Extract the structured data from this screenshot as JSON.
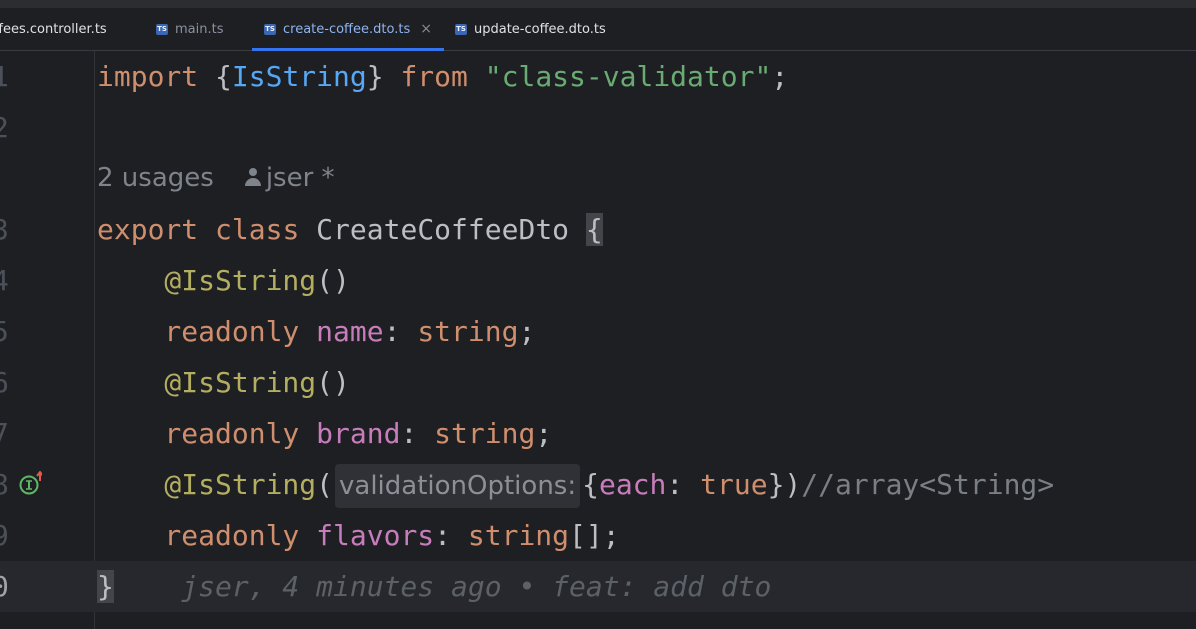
{
  "tabs": [
    {
      "label": "ffees.controller.ts",
      "icon": "ts-file-icon",
      "active": false
    },
    {
      "label": "main.ts",
      "icon": "ts-file-icon",
      "active": false
    },
    {
      "label": "create-coffee.dto.ts",
      "icon": "ts-file-icon",
      "active": true,
      "close": "×"
    },
    {
      "label": "update-coffee.dto.ts",
      "icon": "ts-file-icon",
      "active": false
    }
  ],
  "ts_icon_text": "TS",
  "lines": {
    "l1": {
      "num": "1",
      "import_kw": "import",
      "brace_open": " {",
      "name": "IsString",
      "brace_close": "} ",
      "from_kw": "from",
      "module": " \"class-validator\"",
      "semi": ";"
    },
    "l2": {
      "num": "2"
    },
    "usages": {
      "count": "2 usages",
      "author": "jser *"
    },
    "l3": {
      "num": "3",
      "export_kw": "export",
      "class_kw": " class",
      "class_name": " CreateCoffeeDto ",
      "brace": "{"
    },
    "l4": {
      "num": "4",
      "decorator": "    @IsString",
      "args": "()"
    },
    "l5": {
      "num": "5",
      "readonly": "    readonly",
      "field": " name",
      "colon": ": ",
      "type": "string",
      "semi": ";"
    },
    "l6": {
      "num": "6",
      "decorator": "    @IsString",
      "args": "()"
    },
    "l7": {
      "num": "7",
      "readonly": "    readonly",
      "field": " brand",
      "colon": ": ",
      "type": "string",
      "semi": ";"
    },
    "l8": {
      "num": "8",
      "decorator": "    @IsString",
      "paren": "(",
      "hint": "validationOptions:",
      "brace_open": "{",
      "prop": "each",
      "colon": ": ",
      "value": "true",
      "close": "})",
      "comment": "//array<String>"
    },
    "l9": {
      "num": "9",
      "readonly": "    readonly",
      "field": " flavors",
      "colon": ": ",
      "type": "string",
      "tail": "[];"
    },
    "l10": {
      "num": "0",
      "brace": "}",
      "blame": "    jser, 4 minutes ago • feat: add dto"
    }
  },
  "colors": {
    "keyword": "#cf8e6d",
    "string": "#6aab73",
    "decorator": "#b3ae60",
    "field": "#c77dbb",
    "accent": "#3574f0"
  }
}
